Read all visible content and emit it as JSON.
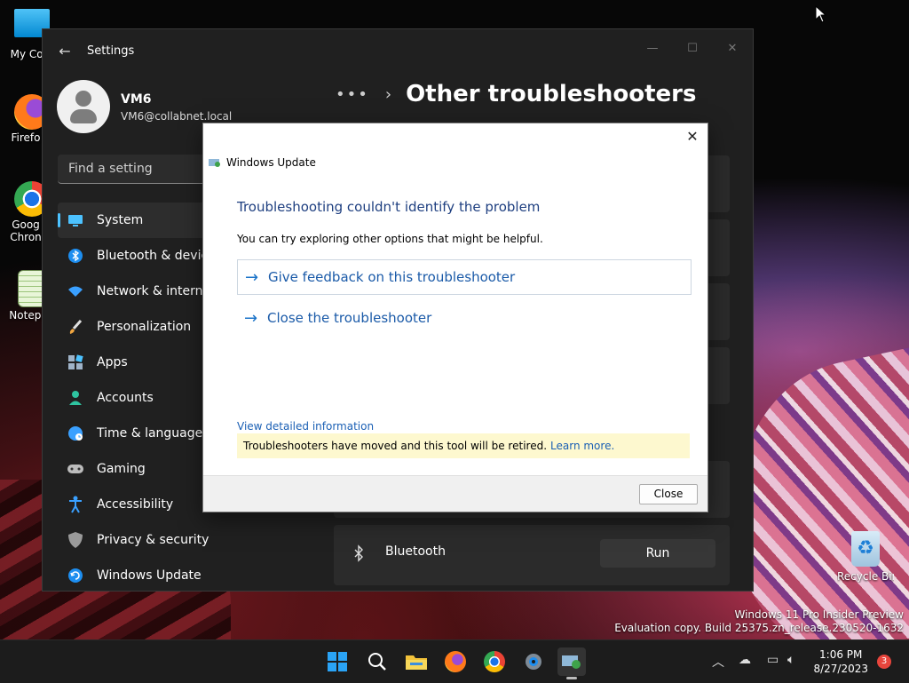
{
  "desktop": {
    "icons": [
      {
        "label": "My Com"
      },
      {
        "label": "Firefo"
      },
      {
        "label": "Goog\nChron"
      },
      {
        "label": "Notepa"
      }
    ],
    "recycle_bin": "Recycle Bin",
    "watermark": {
      "line1": "Windows 11 Pro Insider Preview",
      "line2": "Evaluation copy. Build 25375.zn_release.230520-1632"
    }
  },
  "settings": {
    "app_title": "Settings",
    "profile": {
      "name": "VM6",
      "email": "VM6@collabnet.local"
    },
    "search": {
      "placeholder": "Find a setting"
    },
    "nav": [
      {
        "label": "System",
        "icon": "monitor-icon",
        "active": true
      },
      {
        "label": "Bluetooth & devices",
        "icon": "bluetooth-icon"
      },
      {
        "label": "Network & internet",
        "icon": "wifi-icon"
      },
      {
        "label": "Personalization",
        "icon": "brush-icon"
      },
      {
        "label": "Apps",
        "icon": "apps-icon"
      },
      {
        "label": "Accounts",
        "icon": "person-icon"
      },
      {
        "label": "Time & language",
        "icon": "globe-icon"
      },
      {
        "label": "Gaming",
        "icon": "gamepad-icon"
      },
      {
        "label": "Accessibility",
        "icon": "accessibility-icon"
      },
      {
        "label": "Privacy & security",
        "icon": "shield-icon"
      },
      {
        "label": "Windows Update",
        "icon": "update-icon"
      }
    ],
    "breadcrumb": {
      "more": "•••",
      "title": "Other troubleshooters"
    },
    "bluetooth_card": {
      "label": "Bluetooth",
      "button": "Run"
    }
  },
  "dialog": {
    "title": "Windows Update",
    "heading": "Troubleshooting couldn't identify the problem",
    "subtext": "You can try exploring other options that might be helpful.",
    "options": [
      {
        "label": "Give feedback on this troubleshooter"
      },
      {
        "label": "Close the troubleshooter"
      }
    ],
    "details_link": "View detailed information",
    "notice": {
      "text": "Troubleshooters have moved and this tool will be retired.",
      "link": "Learn more."
    },
    "close_button": "Close"
  },
  "taskbar": {
    "clock": {
      "time": "1:06 PM",
      "date": "8/27/2023"
    },
    "notification_count": "3"
  }
}
